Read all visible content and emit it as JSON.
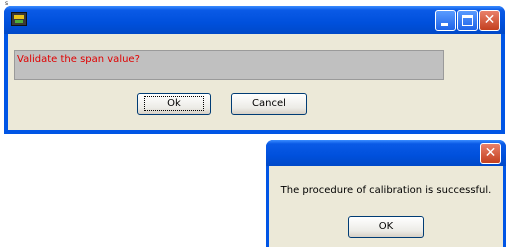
{
  "corner_mark": "s",
  "dialog1": {
    "title": "",
    "message": "Validate the span value?",
    "ok_label": "Ok",
    "cancel_label": "Cancel",
    "icon": "app-icon"
  },
  "dialog2": {
    "title": "",
    "message": "The procedure of calibration is successful.",
    "ok_label": "OK"
  },
  "colors": {
    "titlebar": "#0a5ae6",
    "client_bg": "#ece9d8",
    "message_text": "#e00000",
    "close_button": "#c3401f"
  }
}
